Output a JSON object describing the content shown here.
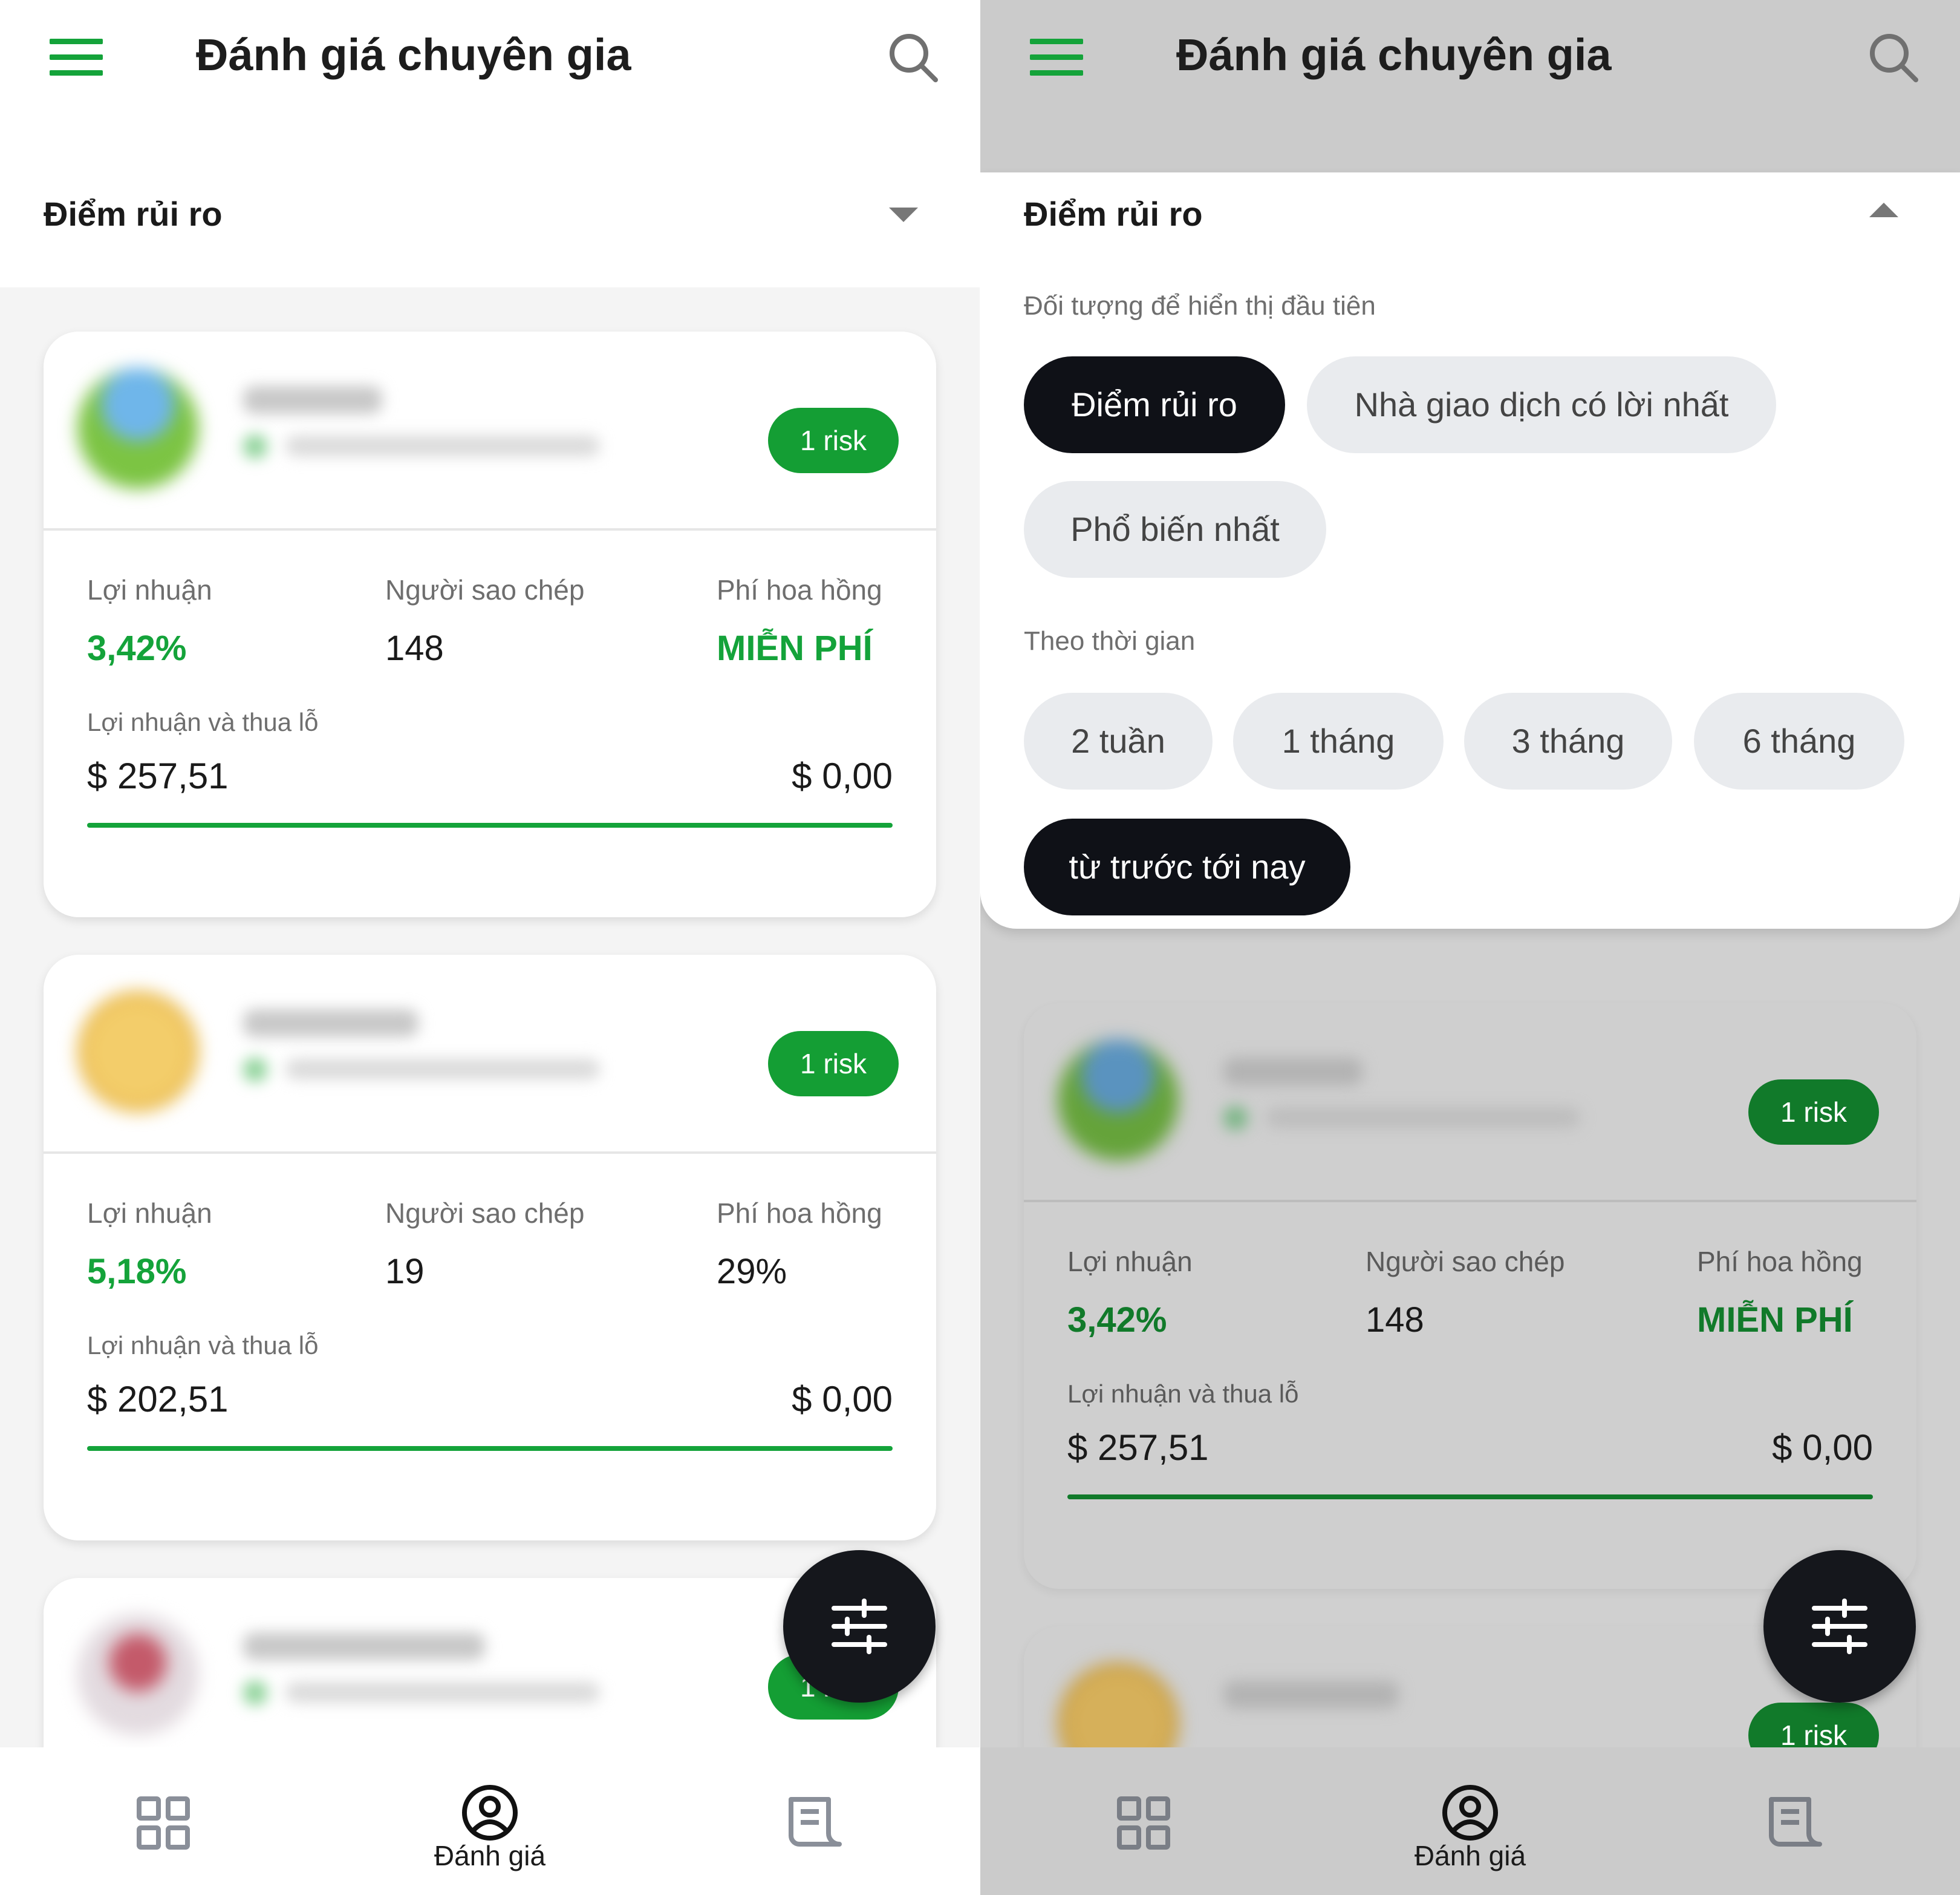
{
  "header": {
    "title": "Đánh giá chuyên gia"
  },
  "selector": {
    "label": "Điểm rủi ro"
  },
  "cards": [
    {
      "badge": "1 risk",
      "profit_label": "Lợi nhuận",
      "profit_value": "3,42%",
      "copiers_label": "Người sao chép",
      "copiers_value": "148",
      "commission_label": "Phí hoa hồng",
      "commission_value": "MIỄN PHÍ",
      "pnl_label": "Lợi nhuận và thua lỗ",
      "pnl_left": "$ 257,51",
      "pnl_right": "$ 0,00"
    },
    {
      "badge": "1 risk",
      "profit_label": "Lợi nhuận",
      "profit_value": "5,18%",
      "copiers_label": "Người sao chép",
      "copiers_value": "19",
      "commission_label": "Phí hoa hồng",
      "commission_value": "29%",
      "pnl_label": "Lợi nhuận và thua lỗ",
      "pnl_left": "$ 202,51",
      "pnl_right": "$ 0,00"
    },
    {
      "badge": "1 risk"
    }
  ],
  "filters": {
    "section1_label": "Đối tượng để hiển thị đầu tiên",
    "sort_options": [
      "Điểm rủi ro",
      "Nhà giao dịch có lời nhất",
      "Phổ biến nhất"
    ],
    "section2_label": "Theo thời gian",
    "time_options": [
      "2 tuần",
      "1 tháng",
      "3 tháng",
      "6 tháng",
      "từ trước tới nay"
    ]
  },
  "bottom_nav": {
    "center_label": "Đánh giá"
  },
  "icons": {
    "menu": "hamburger-icon",
    "search": "search-icon",
    "filter": "sliders-icon",
    "nav_left": "grid-icon",
    "nav_center": "user-circle-icon",
    "nav_right": "document-icon"
  },
  "colors": {
    "accent": "#14a33a",
    "dark": "#0f1117",
    "chip_bg": "#e9ebee"
  }
}
